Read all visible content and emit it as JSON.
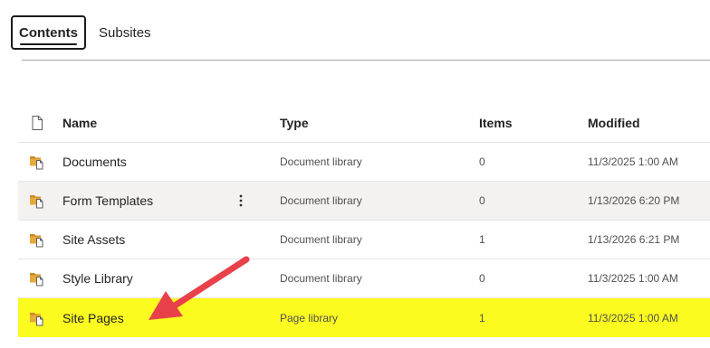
{
  "tabs": [
    {
      "label": "Contents",
      "active": true
    },
    {
      "label": "Subsites",
      "active": false
    }
  ],
  "columns": {
    "name": "Name",
    "type": "Type",
    "items": "Items",
    "modified": "Modified"
  },
  "rows": [
    {
      "name": "Documents",
      "type": "Document library",
      "items": "0",
      "modified": "11/3/2025 1:00 AM",
      "icon": "library-icon"
    },
    {
      "name": "Form Templates",
      "type": "Document library",
      "items": "0",
      "modified": "1/13/2026 6:20 PM",
      "icon": "library-icon",
      "hovered": true
    },
    {
      "name": "Site Assets",
      "type": "Document library",
      "items": "1",
      "modified": "1/13/2026 6:21 PM",
      "icon": "library-icon"
    },
    {
      "name": "Style Library",
      "type": "Document library",
      "items": "0",
      "modified": "11/3/2025 1:00 AM",
      "icon": "library-icon"
    },
    {
      "name": "Site Pages",
      "type": "Page library",
      "items": "1",
      "modified": "11/3/2025 1:00 AM",
      "icon": "library-icon",
      "highlighted": true
    }
  ],
  "colors": {
    "highlight": "#fbfb20",
    "hover": "#f3f2f1",
    "arrow": "#e8414a",
    "icon_folder": "#e8a93c"
  },
  "icons": {
    "header_file": "file-icon",
    "more": "more-vertical-icon"
  }
}
